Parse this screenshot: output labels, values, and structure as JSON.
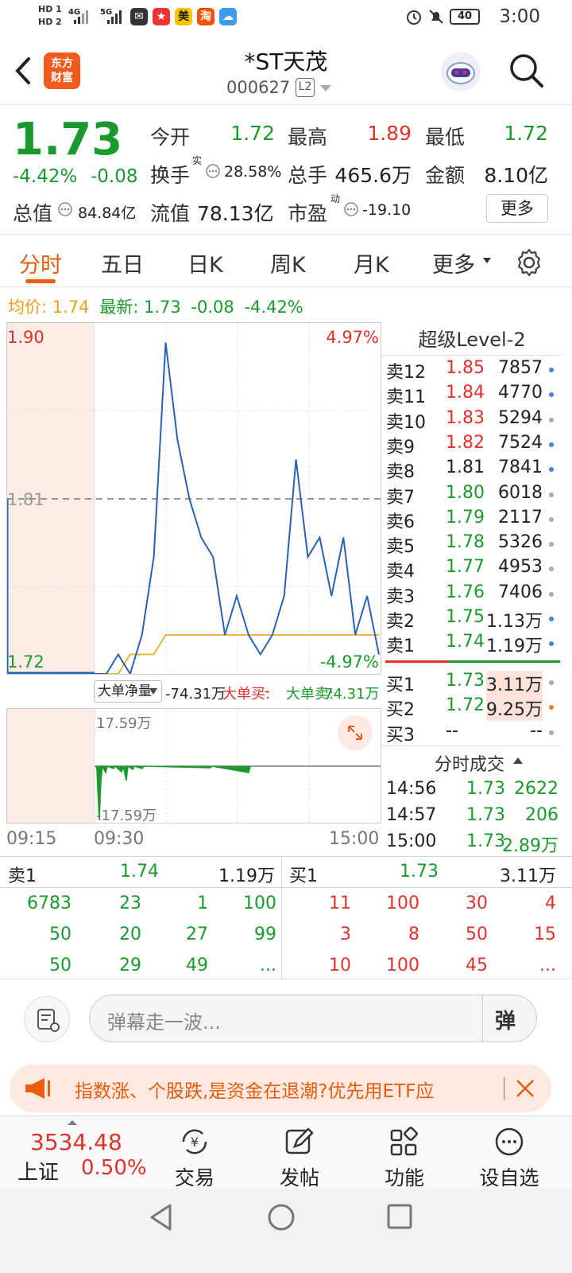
{
  "status_bar": {
    "hd1": "HD 1",
    "hd2": "HD 2",
    "net1": "4G",
    "net2": "5G",
    "app1": "美",
    "app2": "淘",
    "battery": "40",
    "time": "3:00"
  },
  "header": {
    "logo_line1": "东方",
    "logo_line2": "财富",
    "stock_name": "*ST天茂",
    "stock_code": "000627",
    "level_badge": "L2"
  },
  "quote": {
    "price": "1.73",
    "change_pct": "-4.42%",
    "change": "-0.08",
    "open_label": "今开",
    "open": "1.72",
    "high_label": "最高",
    "high": "1.89",
    "low_label": "最低",
    "low": "1.72",
    "turnover_label": "换手",
    "turnover_sup": "实",
    "turnover": "28.58%",
    "volume_label": "总手",
    "volume": "465.6万",
    "amount_label": "金额",
    "amount": "8.10亿",
    "mktcap_label": "总值",
    "mktcap": "84.84亿",
    "float_label": "流值",
    "float_cap": "78.13亿",
    "pe_label": "市盈",
    "pe_sup": "动",
    "pe": "-19.10",
    "more": "更多"
  },
  "tabs": [
    "分时",
    "五日",
    "日K",
    "周K",
    "月K",
    "更多"
  ],
  "avg_info": {
    "avg_label": "均价:",
    "avg": "1.74",
    "latest_label": "最新:",
    "latest": "1.73",
    "change": "-0.08",
    "change_pct": "-4.42%"
  },
  "chart": {
    "y_max": "1.90",
    "y_mid": "1.81",
    "y_min": "1.72",
    "pct_max": "4.97%",
    "pct_min": "-4.97%",
    "vol_max": "17.59万",
    "vol_min": "-17.59万",
    "time_start": "09:15",
    "time_open": "09:30",
    "time_end": "15:00",
    "indicator_label": "大单净量",
    "indicator_value": "-74.31万",
    "big_buy_label": "大单买:",
    "big_buy": "--",
    "big_sell_label": "大单卖:",
    "big_sell": "74.31万"
  },
  "chart_data": {
    "type": "line",
    "x_range": [
      "09:30",
      "15:00"
    ],
    "ylim": [
      1.72,
      1.9
    ],
    "reference": 1.81,
    "x": [
      0,
      10,
      20,
      30,
      40,
      50,
      60,
      70,
      80,
      90,
      100,
      110,
      120,
      130,
      140,
      150,
      160,
      170,
      180,
      190,
      200,
      210,
      220,
      230,
      240
    ],
    "price": [
      1.72,
      1.72,
      1.73,
      1.72,
      1.74,
      1.78,
      1.89,
      1.84,
      1.81,
      1.79,
      1.78,
      1.74,
      1.76,
      1.74,
      1.73,
      1.74,
      1.76,
      1.83,
      1.78,
      1.79,
      1.76,
      1.79,
      1.74,
      1.76,
      1.73
    ],
    "avg": [
      1.72,
      1.72,
      1.72,
      1.73,
      1.73,
      1.73,
      1.74,
      1.74,
      1.74,
      1.74,
      1.74,
      1.74,
      1.74,
      1.74,
      1.74,
      1.74,
      1.74,
      1.74,
      1.74,
      1.74,
      1.74,
      1.74,
      1.74,
      1.74,
      1.74
    ]
  },
  "level2": {
    "title": "超级Level-2",
    "asks": [
      {
        "n": "卖12",
        "p": "1.85",
        "v": "7857"
      },
      {
        "n": "卖11",
        "p": "1.84",
        "v": "4770"
      },
      {
        "n": "卖10",
        "p": "1.83",
        "v": "5294"
      },
      {
        "n": "卖9",
        "p": "1.82",
        "v": "7524"
      },
      {
        "n": "卖8",
        "p": "1.81",
        "v": "7841"
      },
      {
        "n": "卖7",
        "p": "1.80",
        "v": "6018"
      },
      {
        "n": "卖6",
        "p": "1.79",
        "v": "2117"
      },
      {
        "n": "卖5",
        "p": "1.78",
        "v": "5326"
      },
      {
        "n": "卖4",
        "p": "1.77",
        "v": "4953"
      },
      {
        "n": "卖3",
        "p": "1.76",
        "v": "7406"
      },
      {
        "n": "卖2",
        "p": "1.75",
        "v": "1.13万"
      },
      {
        "n": "卖1",
        "p": "1.74",
        "v": "1.19万"
      }
    ],
    "bids": [
      {
        "n": "买1",
        "p": "1.73",
        "v": "3.11万"
      },
      {
        "n": "买2",
        "p": "1.72",
        "v": "9.25万"
      },
      {
        "n": "买3",
        "p": "--",
        "v": "--"
      }
    ],
    "ticks_title": "分时成交",
    "ticks": [
      {
        "t": "14:56",
        "p": "1.73",
        "v": "2622"
      },
      {
        "t": "14:57",
        "p": "1.73",
        "v": "206"
      },
      {
        "t": "15:00",
        "p": "1.73",
        "v": "2.89万"
      }
    ]
  },
  "book": {
    "sell_label": "卖1",
    "sell_price": "1.74",
    "sell_vol": "1.19万",
    "buy_label": "买1",
    "buy_price": "1.73",
    "buy_vol": "3.11万",
    "sell_rows": [
      [
        "6783",
        "23",
        "1",
        "100"
      ],
      [
        "50",
        "20",
        "27",
        "99"
      ],
      [
        "50",
        "29",
        "49",
        "..."
      ]
    ],
    "buy_rows": [
      [
        "11",
        "100",
        "30",
        "4"
      ],
      [
        "3",
        "8",
        "50",
        "15"
      ],
      [
        "10",
        "100",
        "45",
        "..."
      ]
    ]
  },
  "danmu": {
    "placeholder": "弹幕走一波...",
    "btn": "弹"
  },
  "notice": "指数涨、个股跌,是资金在退潮?优先用ETF应",
  "bottom_nav": {
    "index_value": "3534.48",
    "index_name": "上证",
    "index_change": "0.50%",
    "trade": "交易",
    "post": "发帖",
    "features": "功能",
    "watch": "设自选"
  }
}
